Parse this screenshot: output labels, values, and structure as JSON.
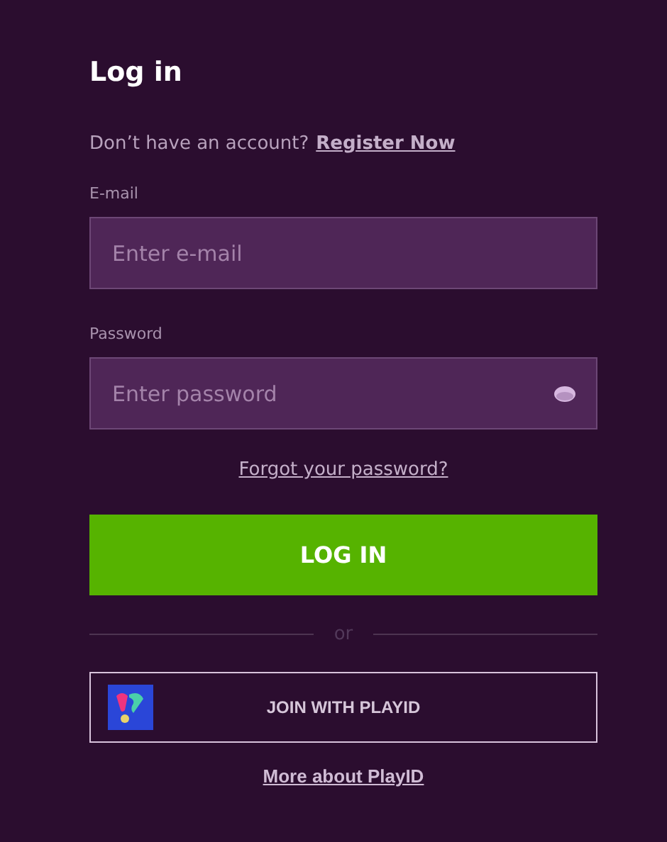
{
  "title": "Log in",
  "register": {
    "prompt": "Don’t have an account?",
    "link": "Register Now"
  },
  "fields": [
    {
      "label": "E-mail",
      "placeholder": "Enter e-mail",
      "kind": "text"
    },
    {
      "label": "Password",
      "placeholder": "Enter password",
      "kind": "password"
    }
  ],
  "forgot_link": "Forgot your password?",
  "login_button": "LOG IN",
  "divider": "or",
  "playid_button": "JOIN WITH PLAYID",
  "more_link": "More about PlayID"
}
